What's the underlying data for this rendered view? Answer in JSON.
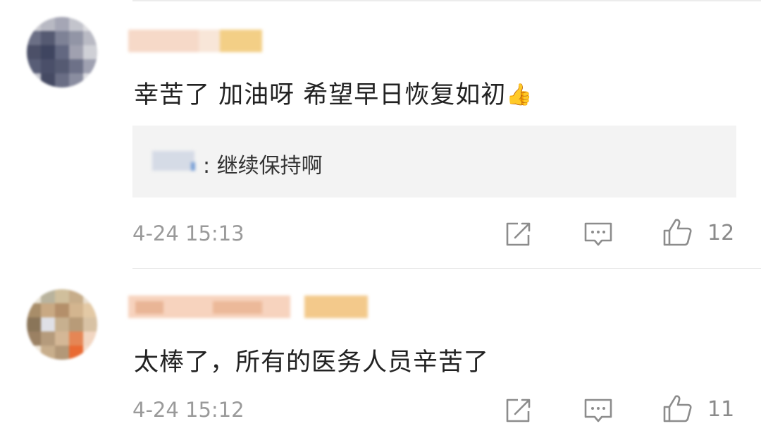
{
  "comments": [
    {
      "text": "幸苦了 加油呀 希望早日恢复如初",
      "emoji": "👍",
      "reply": {
        "separator": ":",
        "text": "继续保持啊"
      },
      "time": "4-24 15:13",
      "likes": "12"
    },
    {
      "text": "太棒了，所有的医务人员辛苦了",
      "time": "4-24 15:12",
      "likes": "11"
    }
  ],
  "icons": [
    "share-icon",
    "comment-icon",
    "like-icon"
  ],
  "colors": {
    "meta_text": "#9a9a9a",
    "icon": "#8c8c8c",
    "reply_bg": "#f3f3f3"
  }
}
